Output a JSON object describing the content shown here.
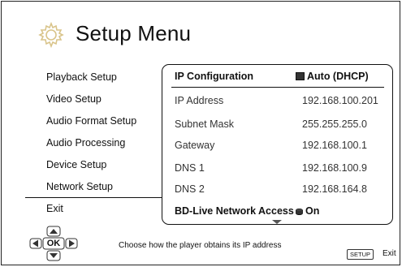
{
  "window": {
    "title": "Setup Menu"
  },
  "icons": {
    "title_icon": "gear-icon"
  },
  "menu": {
    "items": [
      {
        "label": "Playback Setup",
        "selected": false
      },
      {
        "label": "Video Setup",
        "selected": false
      },
      {
        "label": "Audio Format Setup",
        "selected": false
      },
      {
        "label": "Audio Processing",
        "selected": false
      },
      {
        "label": "Device Setup",
        "selected": false
      },
      {
        "label": "Network Setup",
        "selected": true
      },
      {
        "label": "Exit",
        "selected": false
      }
    ]
  },
  "panel": {
    "rows": [
      {
        "label": "IP Configuration",
        "value": "Auto (DHCP)",
        "highlighted": true,
        "icon": "option-square-icon"
      },
      {
        "label": "IP Address",
        "value": "192.168.100.201"
      },
      {
        "label": "Subnet Mask",
        "value": "255.255.255.0"
      },
      {
        "label": "Gateway",
        "value": "192.168.100.1"
      },
      {
        "label": "DNS 1",
        "value": "192.168.100.9"
      },
      {
        "label": "DNS 2",
        "value": "192.168.164.8"
      },
      {
        "label": "BD-Live Network Access",
        "value": "On",
        "highlighted": true,
        "icon": "option-drum-icon"
      }
    ]
  },
  "footer": {
    "ok_label": "OK",
    "help_text": "Choose how the player obtains its IP address",
    "setup_key": "SETUP",
    "exit_label": "Exit"
  },
  "colors": {
    "background": "#ffffff",
    "text": "#111111",
    "gear": "#d9c48a"
  }
}
